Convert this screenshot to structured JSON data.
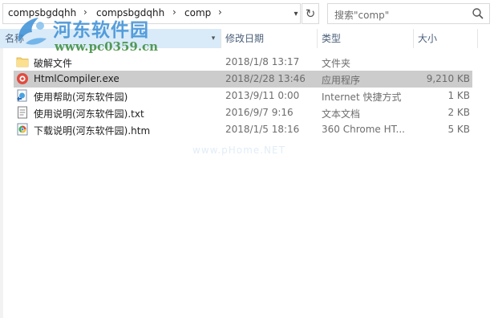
{
  "address": {
    "crumbs": [
      "compsbgdqhh",
      "compsbgdqhh",
      "comp"
    ],
    "separator": "›"
  },
  "search": {
    "placeholder": "搜索\"comp\""
  },
  "columns": {
    "name": "名称",
    "date": "修改日期",
    "type": "类型",
    "size": "大小"
  },
  "files": [
    {
      "name": "破解文件",
      "date": "2018/1/8 13:17",
      "type": "文件夹",
      "size": "",
      "icon": "folder-icon"
    },
    {
      "name": "HtmlCompiler.exe",
      "date": "2018/2/28 13:46",
      "type": "应用程序",
      "size": "9,210 KB",
      "icon": "app-exe-icon",
      "selected": true
    },
    {
      "name": "使用帮助(河东软件园)",
      "date": "2013/9/11 0:00",
      "type": "Internet 快捷方式",
      "size": "1 KB",
      "icon": "internet-shortcut-icon"
    },
    {
      "name": "使用说明(河东软件园).txt",
      "date": "2016/9/7 9:16",
      "type": "文本文档",
      "size": "2 KB",
      "icon": "text-file-icon"
    },
    {
      "name": "下载说明(河东软件园).htm",
      "date": "2018/1/5 18:16",
      "type": "360 Chrome HT...",
      "size": "5 KB",
      "icon": "browser-html-icon"
    }
  ],
  "watermark": {
    "title": "河东软件园",
    "url": "www.pc0359.cn",
    "faint": "www.pHome.NET"
  },
  "colors": {
    "selected_row": "#cccccc",
    "header_hover": "#d9ebf9",
    "watermark_blue": "#3b8fd6"
  }
}
